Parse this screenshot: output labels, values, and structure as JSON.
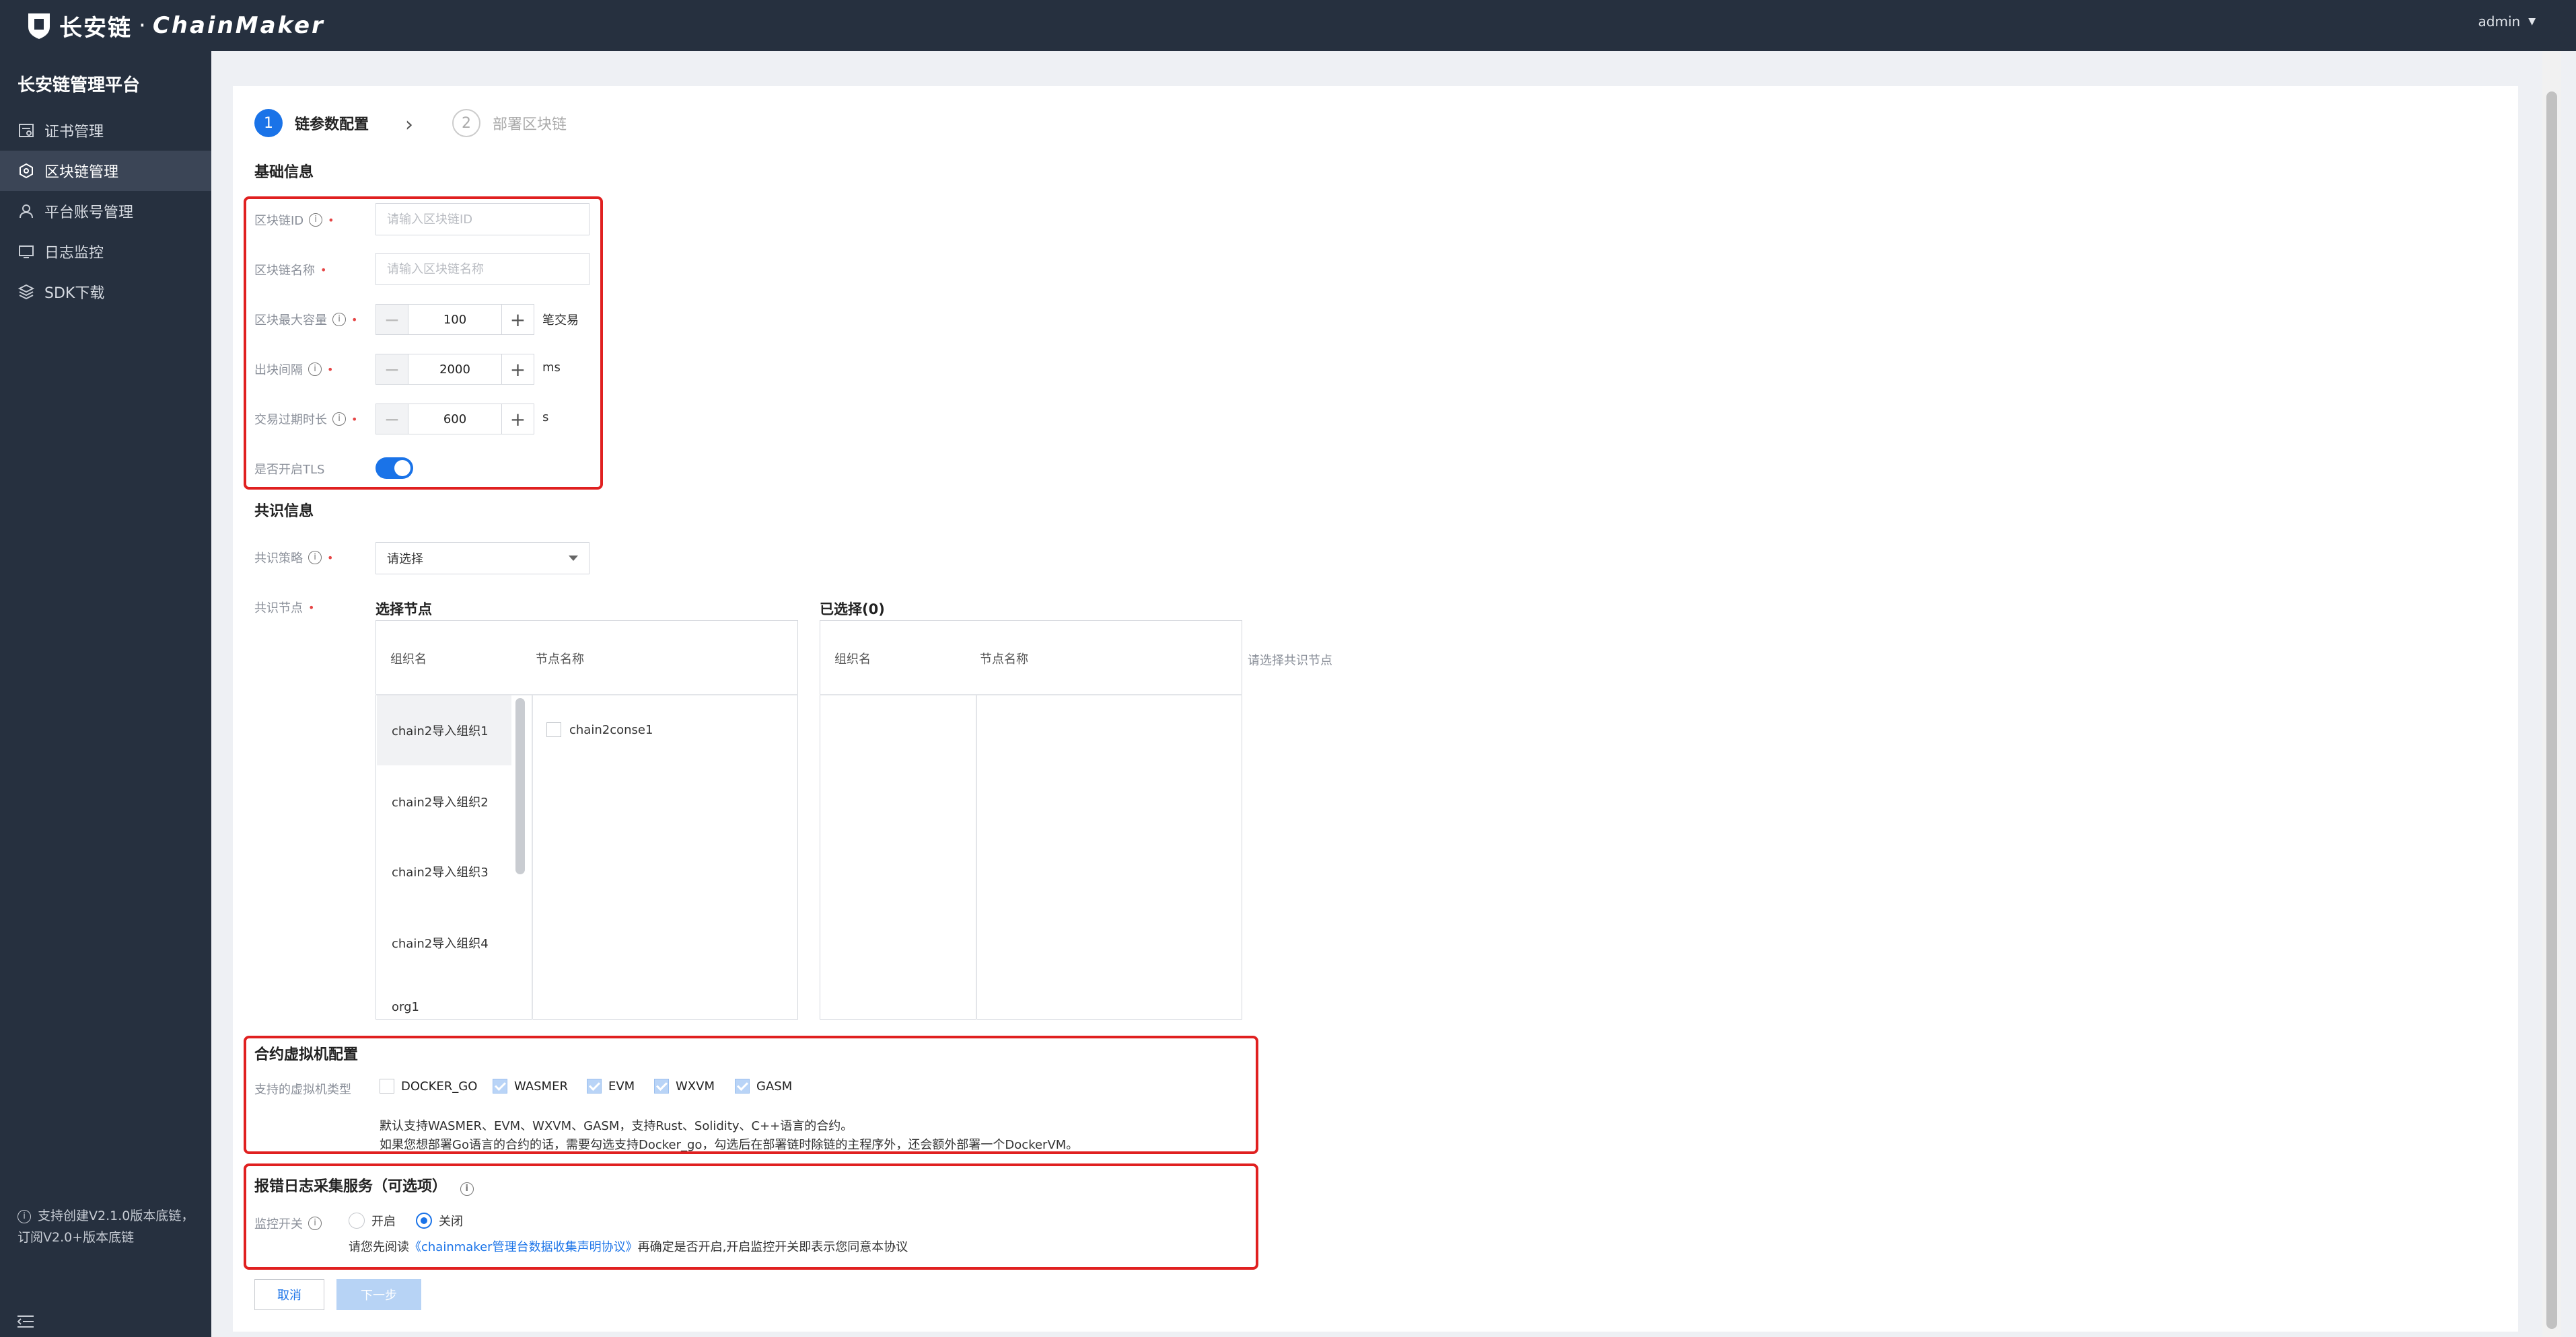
{
  "header": {
    "logo_cn": "长安链",
    "logo_dot": "·",
    "logo_en": "ChainMaker",
    "user": "admin"
  },
  "sidebar": {
    "title": "长安链管理平台",
    "items": [
      {
        "label": "证书管理",
        "icon": "certificate-icon"
      },
      {
        "label": "区块链管理",
        "icon": "blockchain-icon",
        "active": true
      },
      {
        "label": "平台账号管理",
        "icon": "user-icon"
      },
      {
        "label": "日志监控",
        "icon": "monitor-icon"
      },
      {
        "label": "SDK下载",
        "icon": "layers-icon"
      }
    ],
    "note": "支持创建V2.1.0版本底链，订阅V2.0+版本底链"
  },
  "steps": {
    "step1_num": "1",
    "step1_label": "链参数配置",
    "step2_num": "2",
    "step2_label": "部署区块链"
  },
  "basic": {
    "title": "基础信息",
    "chain_id_label": "区块链ID",
    "chain_id_placeholder": "请输入区块链ID",
    "chain_name_label": "区块链名称",
    "chain_name_placeholder": "请输入区块链名称",
    "block_cap_label": "区块最大容量",
    "block_cap_value": "100",
    "block_cap_unit": "笔交易",
    "interval_label": "出块间隔",
    "interval_value": "2000",
    "interval_unit": "ms",
    "expire_label": "交易过期时长",
    "expire_value": "600",
    "expire_unit": "s",
    "tls_label": "是否开启TLS",
    "tls_on": true
  },
  "consensus": {
    "title": "共识信息",
    "strategy_label": "共识策略",
    "strategy_value": "请选择",
    "nodes_label": "共识节点",
    "select_title": "选择节点",
    "selected_title": "已选择(0)",
    "col_org": "组织名",
    "col_node": "节点名称",
    "orgs": [
      "chain2导入组织1",
      "chain2导入组织2",
      "chain2导入组织3",
      "chain2导入组织4",
      "org1"
    ],
    "nodes": [
      "chain2conse1"
    ],
    "hint": "请选择共识节点"
  },
  "vm": {
    "title": "合约虚拟机配置",
    "type_label": "支持的虚拟机类型",
    "options": [
      {
        "label": "DOCKER_GO",
        "checked": false
      },
      {
        "label": "WASMER",
        "checked": true
      },
      {
        "label": "EVM",
        "checked": true
      },
      {
        "label": "WXVM",
        "checked": true
      },
      {
        "label": "GASM",
        "checked": true
      }
    ],
    "note1": "默认支持WASMER、EVM、WXVM、GASM，支持Rust、Solidity、C++语言的合约。",
    "note2": "如果您想部署Go语言的合约的话，需要勾选支持Docker_go，勾选后在部署链时除链的主程序外，还会额外部署一个DockerVM。"
  },
  "log": {
    "title": "报错日志采集服务（可选项）",
    "switch_label": "监控开关",
    "on_label": "开启",
    "off_label": "关闭",
    "selected": "off",
    "notice_prefix": "请您先阅读",
    "notice_link": "《chainmaker管理台数据收集声明协议》",
    "notice_suffix": "再确定是否开启,开启监控开关即表示您同意本协议"
  },
  "actions": {
    "cancel": "取消",
    "next": "下一步"
  },
  "colors": {
    "accent": "#1a73e8",
    "sidebar_bg": "#26303f",
    "highlight_border": "#e02020"
  }
}
